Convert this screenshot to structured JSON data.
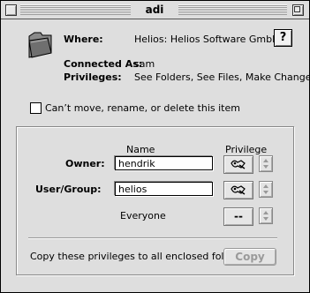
{
  "window": {
    "title": "adi"
  },
  "info": {
    "where_label": "Where:",
    "where_value": "Helios: Helios Software GmbH:",
    "connected_label": "Connected As:",
    "connected_value": "sam",
    "privileges_label": "Privileges:",
    "privileges_value": "See Folders, See Files, Make Changes",
    "help_label": "?"
  },
  "lock_option": {
    "label": "Can’t move, rename, or delete this item",
    "checked": false
  },
  "table": {
    "name_header": "Name",
    "privilege_header": "Privilege",
    "rows": [
      {
        "label": "Owner:",
        "name": "hendrik",
        "privilege_icon": "read-write-icon"
      },
      {
        "label": "User/Group:",
        "name": "helios",
        "privilege_icon": "read-write-icon"
      },
      {
        "label": "Everyone",
        "name": "",
        "privilege_text": "--"
      }
    ]
  },
  "copy": {
    "description": "Copy these privileges to all enclosed folders",
    "button_label": "Copy",
    "button_enabled": false
  }
}
